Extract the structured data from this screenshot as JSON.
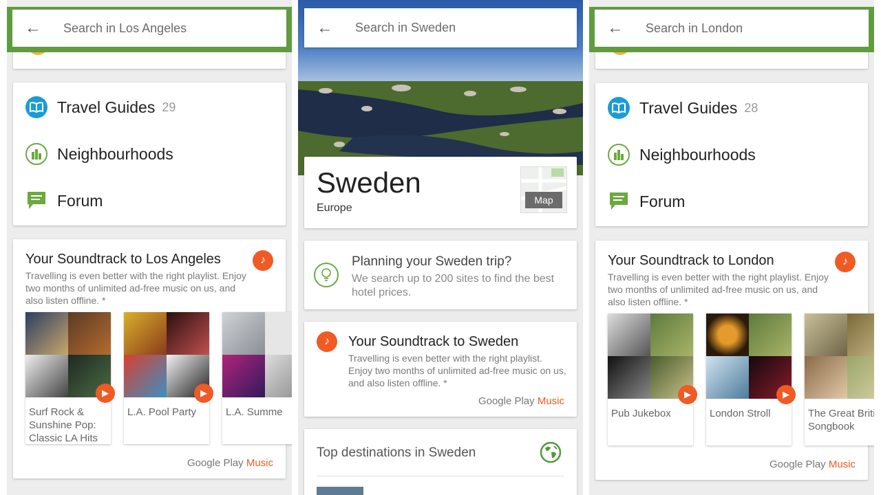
{
  "panels": [
    {
      "search": {
        "back_icon": "arrow-left-icon",
        "placeholder": "Search in Los Angeles"
      },
      "links": [
        {
          "label": "Travel Guides",
          "count": "29",
          "icon": "book-icon"
        },
        {
          "label": "Neighbourhoods",
          "icon": "buildings-icon"
        },
        {
          "label": "Forum",
          "icon": "chat-icon"
        }
      ],
      "soundtrack": {
        "title": "Your Soundtrack to Los Angeles",
        "description": "Travelling is even better with the right playlist. Enjoy two months of unlimited ad-free music on us, and also listen offline. *",
        "playlists": [
          "Surf Rock & Sunshine Pop: Classic LA Hits",
          "L.A. Pool Party",
          "L.A. Summe"
        ],
        "brand": {
          "prefix": "Google Play",
          "suffix": "Music"
        }
      }
    },
    {
      "search": {
        "back_icon": "arrow-left-icon",
        "placeholder": "Search in Sweden"
      },
      "country": {
        "name": "Sweden",
        "region": "Europe",
        "map_label": "Map"
      },
      "planning": {
        "title": "Planning your Sweden trip?",
        "description": "We search up to 200 sites to find the best hotel prices."
      },
      "soundtrack": {
        "title": "Your Soundtrack to Sweden",
        "description": "Travelling is even better with the right playlist. Enjoy two months of unlimited ad-free music on us, and also listen offline. *",
        "brand": {
          "prefix": "Google Play",
          "suffix": "Music"
        }
      },
      "destinations": {
        "title": "Top destinations in Sweden"
      }
    },
    {
      "search": {
        "back_icon": "arrow-left-icon",
        "placeholder": "Search in London"
      },
      "links": [
        {
          "label": "Travel Guides",
          "count": "28",
          "icon": "book-icon"
        },
        {
          "label": "Neighbourhoods",
          "icon": "buildings-icon"
        },
        {
          "label": "Forum",
          "icon": "chat-icon"
        }
      ],
      "soundtrack": {
        "title": "Your Soundtrack to London",
        "description": "Travelling is even better with the right playlist. Enjoy two months of unlimited ad-free music on us, and also listen offline. *",
        "playlists": [
          "Pub Jukebox",
          "London Stroll",
          "The Great British Songbook"
        ],
        "brand": {
          "prefix": "Google Play",
          "suffix": "Music"
        }
      }
    }
  ],
  "colors": {
    "accent_green": "#5f9c3e",
    "travel_blue": "#1a9bd7",
    "music_orange": "#f05a24",
    "forum_green": "#6aaa3f"
  }
}
